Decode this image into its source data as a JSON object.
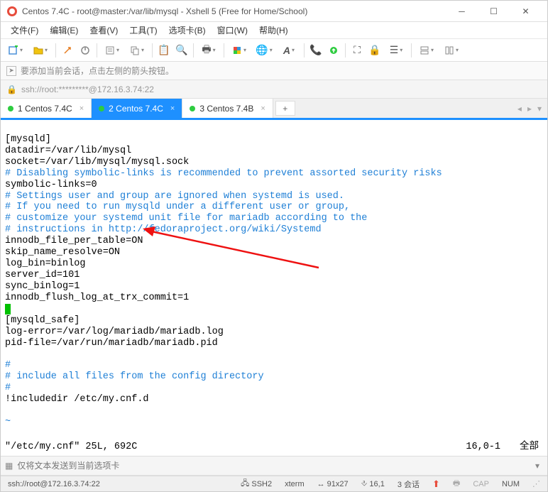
{
  "window": {
    "title": "Centos 7.4C - root@master:/var/lib/mysql - Xshell 5 (Free for Home/School)"
  },
  "menu": {
    "file": "文件(F)",
    "edit": "编辑(E)",
    "view": "查看(V)",
    "tools": "工具(T)",
    "tabs": "选项卡(B)",
    "window": "窗口(W)",
    "help": "帮助(H)"
  },
  "info": {
    "text": "要添加当前会话，点击左侧的箭头按钮。"
  },
  "address": {
    "text": "ssh://root:*********@172.16.3.74:22"
  },
  "tabs": {
    "items": [
      {
        "label": "1 Centos 7.4C",
        "active": false
      },
      {
        "label": "2 Centos 7.4C",
        "active": true
      },
      {
        "label": "3 Centos 7.4B",
        "active": false
      }
    ]
  },
  "terminal": {
    "l1": "[mysqld]",
    "l2": "datadir=/var/lib/mysql",
    "l3": "socket=/var/lib/mysql/mysql.sock",
    "l4": "# Disabling symbolic-links is recommended to prevent assorted security risks",
    "l5": "symbolic-links=0",
    "l6": "# Settings user and group are ignored when systemd is used.",
    "l7": "# If you need to run mysqld under a different user or group,",
    "l8": "# customize your systemd unit file for mariadb according to the",
    "l9": "# instructions in http://fedoraproject.org/wiki/Systemd",
    "l10": "innodb_file_per_table=ON",
    "l11": "skip_name_resolve=ON",
    "l12": "log_bin=binlog",
    "l13": "server_id=101",
    "l14": "sync_binlog=1",
    "l15": "innodb_flush_log_at_trx_commit=1",
    "l17": "[mysqld_safe]",
    "l18": "log-error=/var/log/mariadb/mariadb.log",
    "l19": "pid-file=/var/run/mariadb/mariadb.pid",
    "l21": "#",
    "l22": "# include all files from the config directory",
    "l23": "#",
    "l24": "!includedir /etc/my.cnf.d",
    "tilde": "~",
    "status_file": "\"/etc/my.cnf\" 25L, 692C",
    "status_pos": "16,0-1",
    "status_pct": "全部"
  },
  "sendbar": {
    "placeholder": "仅将文本发送到当前选项卡"
  },
  "statusbar": {
    "conn": "ssh://root@172.16.3.74:22",
    "proto": "SSH2",
    "term": "xterm",
    "size": "91x27",
    "cursor": "16,1",
    "sessions_label": "3 会话",
    "cap": "CAP",
    "num": "NUM"
  }
}
